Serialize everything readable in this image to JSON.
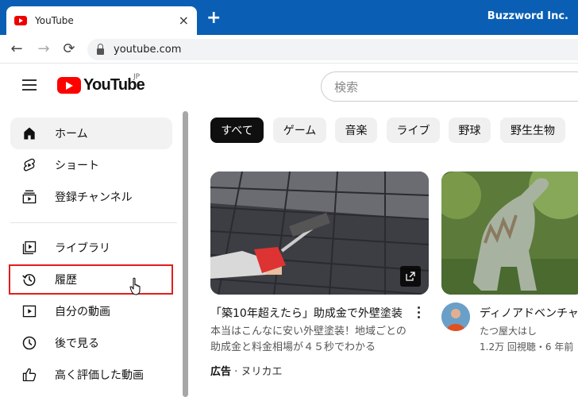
{
  "browser": {
    "tab_title": "YouTube",
    "tab_close": "×",
    "new_tab": "+",
    "brand": "Buzzword Inc.",
    "url": "youtube.com",
    "back": "←",
    "forward": "→",
    "reload": "⟳"
  },
  "masthead": {
    "logo_text": "YouTube",
    "region": "JP",
    "search_placeholder": "検索"
  },
  "sidebar": {
    "items": [
      {
        "label": "ホーム",
        "icon": "home-icon",
        "active": true
      },
      {
        "label": "ショート",
        "icon": "shorts-icon"
      },
      {
        "label": "登録チャンネル",
        "icon": "subscriptions-icon"
      },
      {
        "label": "ライブラリ",
        "icon": "library-icon"
      },
      {
        "label": "履歴",
        "icon": "history-icon",
        "highlighted": true
      },
      {
        "label": "自分の動画",
        "icon": "your-videos-icon"
      },
      {
        "label": "後で見る",
        "icon": "watch-later-icon"
      },
      {
        "label": "高く評価した動画",
        "icon": "liked-videos-icon"
      }
    ]
  },
  "chips": [
    "すべて",
    "ゲーム",
    "音楽",
    "ライブ",
    "野球",
    "野生生物"
  ],
  "videos": [
    {
      "title": "「築10年超えたら」助成金で外壁塗装",
      "desc_line1": "本当はこんなに安い外壁塗装！地域ごとの",
      "desc_line2": "助成金と料金相場が４５秒でわかる",
      "ad_label": "広告",
      "ad_sep": "·",
      "advertiser": "ヌリカエ"
    },
    {
      "title": "ディノアドベンチャ",
      "channel": "たつ屋大はし",
      "meta": "1.2万 回視聴・6 年前"
    }
  ],
  "colors": {
    "accent": "#ff0000",
    "highlight": "#e31d1d",
    "chrome": "#0a5fb4"
  }
}
